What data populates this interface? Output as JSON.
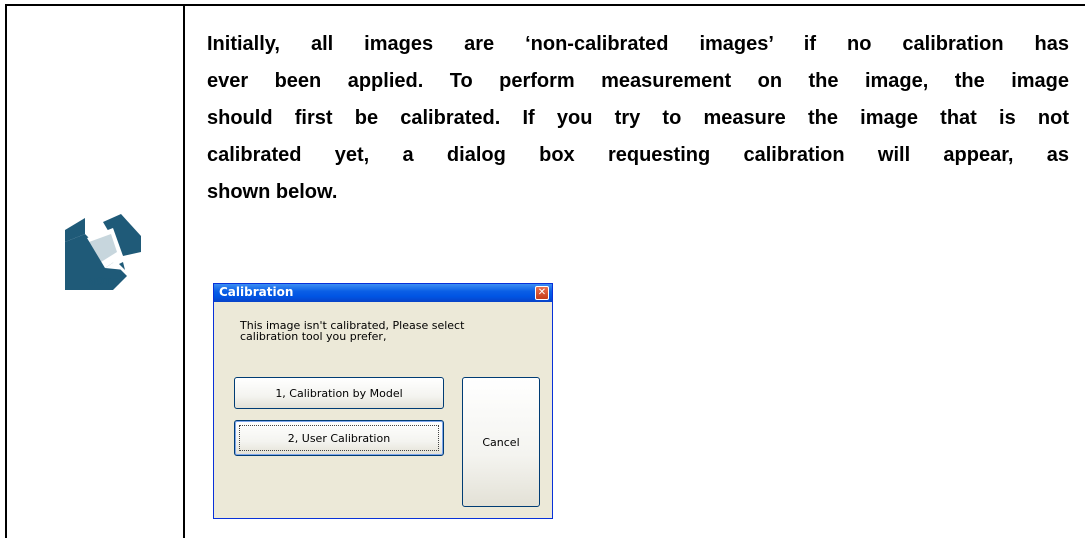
{
  "note": {
    "icon": "pencil-note-icon",
    "label": "NOTE",
    "colors": {
      "icon_dark": "#1f5a78",
      "icon_light": "#ffffff"
    }
  },
  "paragraph": {
    "lines": [
      "Initially, all images are ‘non-calibrated images’ if no calibration has",
      "ever been applied. To perform measurement on the image, the image",
      "should first be calibrated. If you try to measure the image that is not",
      "calibrated yet, a dialog box requesting calibration will appear, as",
      "shown below."
    ]
  },
  "dialog": {
    "title": "Calibration",
    "close_icon": "close-icon",
    "message_lines": [
      "This image isn't calibrated, Please select",
      "calibration tool you prefer,"
    ],
    "buttons": {
      "model": "1, Calibration by Model",
      "user": "2, User Calibration",
      "cancel": "Cancel"
    },
    "colors": {
      "title_bar": "#0054e3",
      "background": "#ece9d8",
      "close": "#c33b1a"
    }
  }
}
